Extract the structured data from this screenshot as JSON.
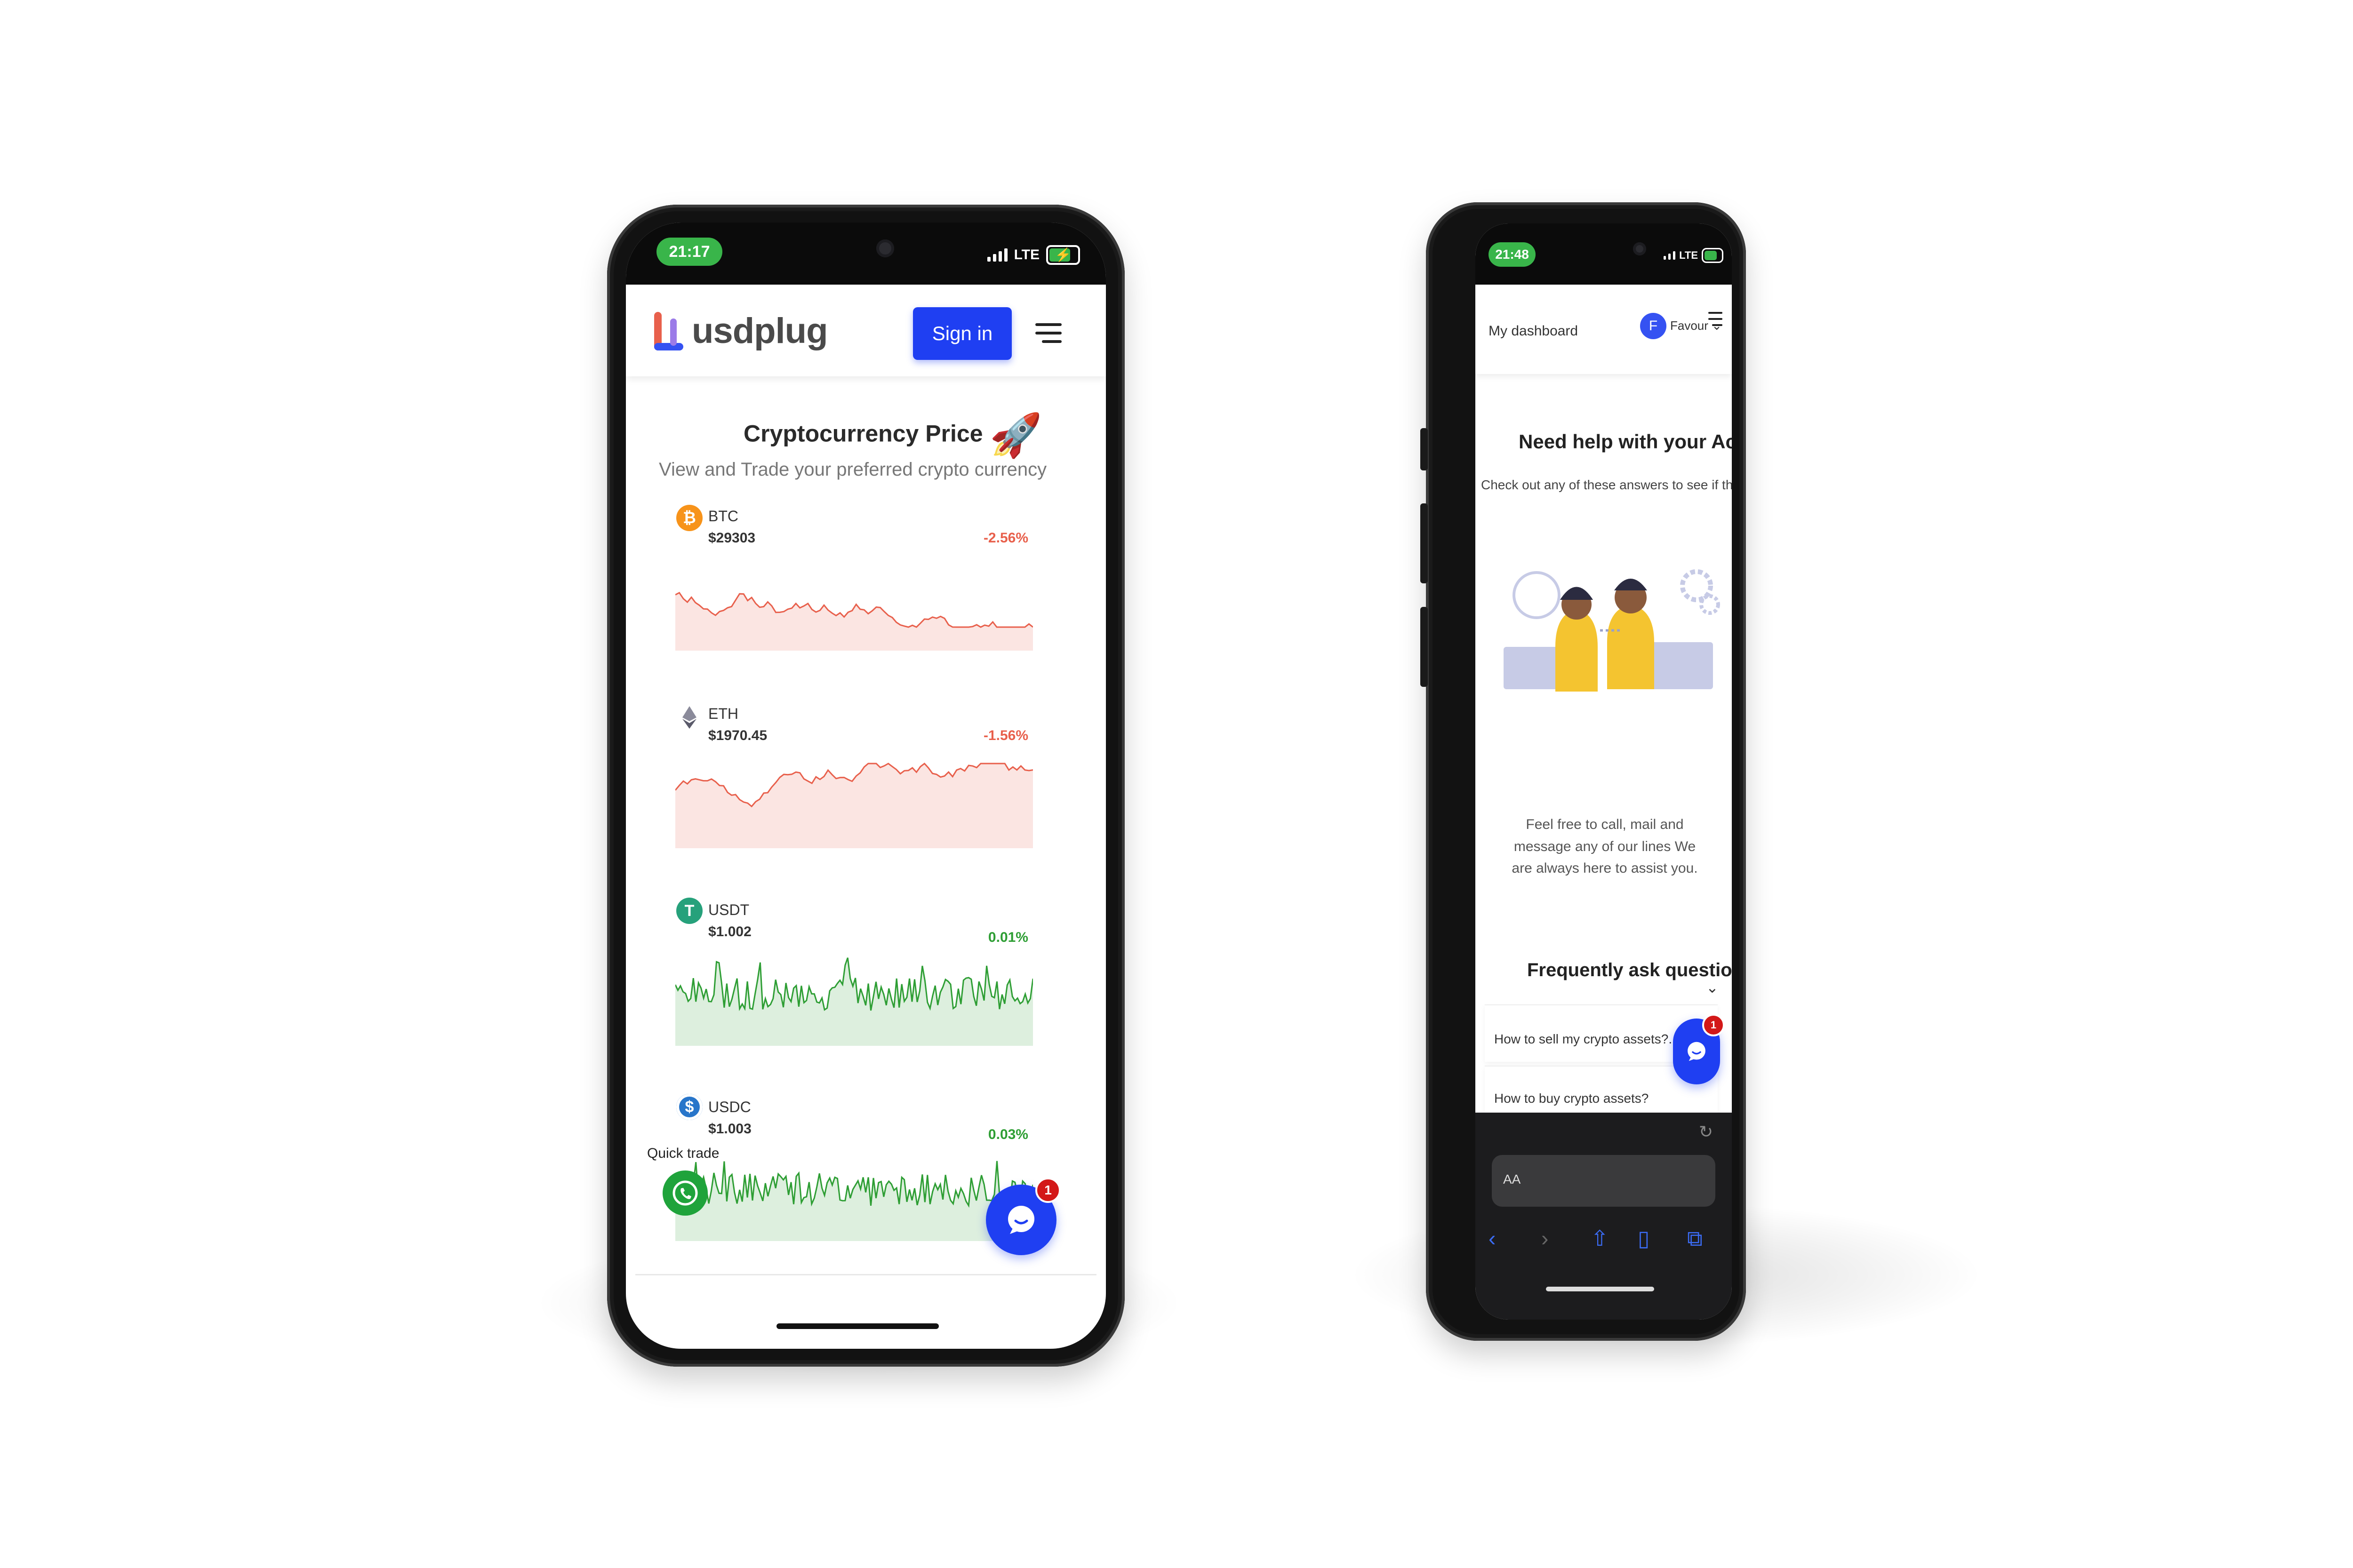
{
  "left_phone": {
    "status": {
      "time": "21:17",
      "network": "LTE"
    },
    "header": {
      "logo_text": "usdplug",
      "signin_label": "Sign in"
    },
    "hero": {
      "title": "Cryptocurrency Price",
      "title_emoji": "🚀",
      "subtitle": "View and Trade your preferred crypto currency"
    },
    "coins": [
      {
        "symbol": "BTC",
        "price": "$29303",
        "change": "-2.56%",
        "trend": "down",
        "icon_glyph": "₿",
        "icon_color": "#f7931a"
      },
      {
        "symbol": "ETH",
        "price": "$1970.45",
        "change": "-1.56%",
        "trend": "down",
        "icon_glyph": "◆",
        "icon_color": "#ffffff"
      },
      {
        "symbol": "USDT",
        "price": "$1.002",
        "change": "0.01%",
        "trend": "up",
        "icon_glyph": "T",
        "icon_color": "#26a17b"
      },
      {
        "symbol": "USDC",
        "price": "$1.003",
        "change": "0.03%",
        "trend": "up",
        "icon_glyph": "$",
        "icon_color": "#2775ca"
      }
    ],
    "quicktrade_label": "Quick trade",
    "chat_badge": "1"
  },
  "right_phone": {
    "status": {
      "time": "21:48",
      "network": "LTE"
    },
    "header": {
      "dashboard_label": "My dashboard",
      "avatar_initial": "F",
      "user_name": "Favour"
    },
    "help": {
      "title": "Need help with your Account ?",
      "subtitle": "Check out any of these answers to see if they will help",
      "paragraph": "Feel free to call, mail and message any of our lines We are always here to assist you."
    },
    "faq": {
      "title": "Frequently ask questions",
      "items": [
        "How to sell my crypto assets?.",
        "How to buy crypto assets?"
      ]
    },
    "chat_badge": "1",
    "browser": {
      "text_size_label": "AA"
    }
  },
  "colors": {
    "brand_blue": "#1f3ff2",
    "status_green": "#39b54a",
    "down_red": "#e8604c",
    "up_green": "#2e9e34",
    "whatsapp_green": "#1fa33b",
    "badge_red": "#d31818"
  }
}
